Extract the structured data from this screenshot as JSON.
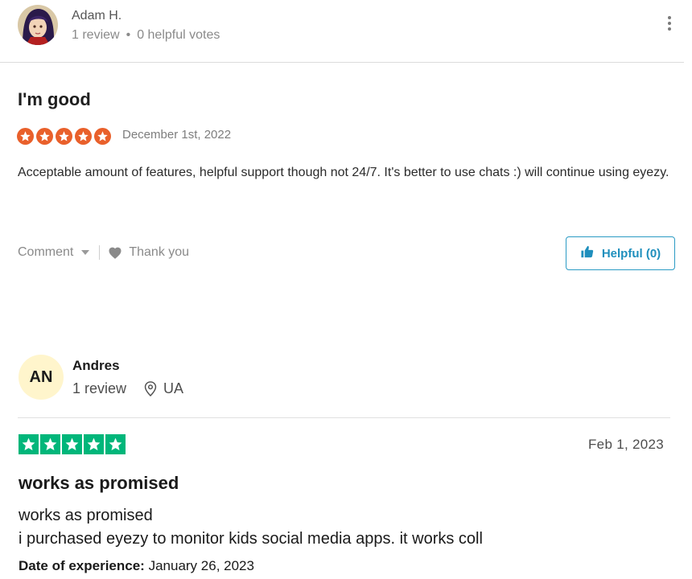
{
  "review1": {
    "author": "Adam H.",
    "review_count": "1 review",
    "separator": "•",
    "helpful_votes": "0 helpful votes",
    "title": "I'm good",
    "rating": 5,
    "star_color": "#e9602b",
    "date": "December 1st, 2022",
    "body": "Acceptable amount of features, helpful support though not 24/7. It's better to use chats :) will continue using eyezy.",
    "comment_label": "Comment",
    "thank_you_label": "Thank you",
    "helpful_label": "Helpful (0)",
    "accent_color": "#1f8fbd"
  },
  "review2": {
    "avatar_initials": "AN",
    "author": "Andres",
    "review_count": "1 review",
    "country": "UA",
    "rating": 5,
    "star_color": "#00b67a",
    "date": "Feb 1, 2023",
    "title": "works as promised",
    "body_line1": "works as promised",
    "body_line2": "i purchased eyezy to monitor kids social media apps. it works coll",
    "experience_label": "Date of experience:",
    "experience_date": "January 26, 2023"
  }
}
